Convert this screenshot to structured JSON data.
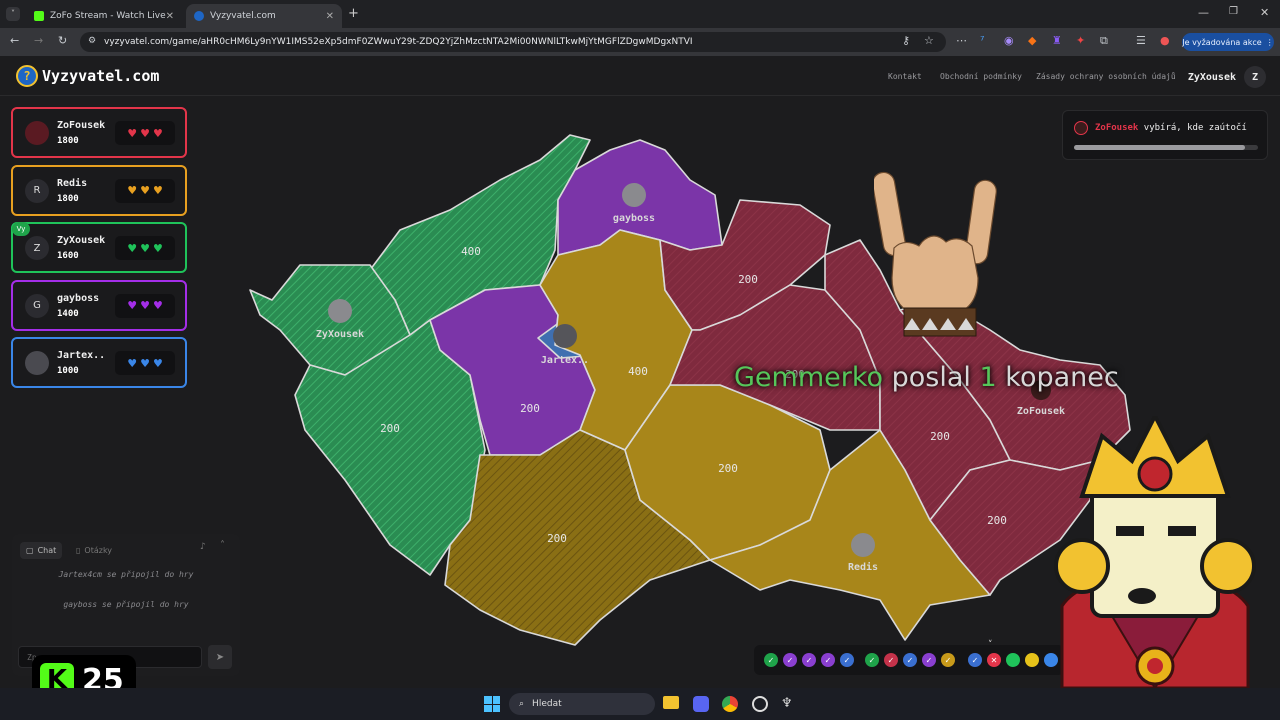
{
  "browser": {
    "tabs": [
      {
        "title": "ZoFo Stream - Watch Live on Ki",
        "active": false
      },
      {
        "title": "Vyzyvatel.com",
        "active": true
      }
    ],
    "url": "vyzyvatel.com/game/aHR0cHM6Ly9nYW1IMS52eXp5dmF0ZWwuY29t-ZDQ2YjZhMzctNTA2Mi00NWNlLTkwMjYtMGFlZDgwMDgxNTVI",
    "action_button": "Je vyžadována akce"
  },
  "site": {
    "logo": "Vyzyvatel.com",
    "nav": [
      "Kontakt",
      "Obchodní podmínky",
      "Zásady ochrany osobních údajů"
    ],
    "user": {
      "name": "ZyXousek",
      "initial": "Z"
    }
  },
  "players": [
    {
      "name": "ZoFousek",
      "score": "1800",
      "initial": "",
      "color": "#e3354a",
      "hearts": 3,
      "you": false
    },
    {
      "name": "Redis",
      "score": "1800",
      "initial": "R",
      "color": "#e8a020",
      "hearts": 3,
      "you": false
    },
    {
      "name": "ZyXousek",
      "score": "1600",
      "initial": "Z",
      "color": "#1fc35a",
      "hearts": 3,
      "you": true,
      "you_label": "Vy"
    },
    {
      "name": "gayboss",
      "score": "1400",
      "initial": "G",
      "color": "#a42ee8",
      "hearts": 3,
      "you": false
    },
    {
      "name": "Jartex..",
      "score": "1000",
      "initial": "",
      "color": "#3a86e8",
      "hearts": 3,
      "you": false
    }
  ],
  "status": {
    "player": "ZoFousek",
    "text": "vybírá, kde zaútočí",
    "progress": 0.93
  },
  "chat": {
    "tabs": [
      "Chat",
      "Otázky"
    ],
    "messages": [
      "Jartex4cm se připojil do hry",
      "gayboss se připojil do hry"
    ],
    "placeholder": "Zp..."
  },
  "map": {
    "regions": [
      {
        "id": "liberec-ustecky",
        "owner": "ZyXousek",
        "value": "400"
      },
      {
        "id": "karlovarsky",
        "owner": "ZyXousek",
        "value": "ZyXousek"
      },
      {
        "id": "plzensky",
        "owner": "ZyXousek",
        "value": "200"
      },
      {
        "id": "liberecky",
        "owner": "gayboss",
        "value": "gayboss"
      },
      {
        "id": "stredocesky-west",
        "owner": "gayboss",
        "value": "200"
      },
      {
        "id": "praha",
        "owner": "Jartex..",
        "value": "Jartex.."
      },
      {
        "id": "stredocesky-east",
        "owner": "Redis",
        "value": "400"
      },
      {
        "id": "jihocesky",
        "owner": "Redis",
        "value": "200"
      },
      {
        "id": "vysocina",
        "owner": "Redis",
        "value": "200"
      },
      {
        "id": "jihomoravsky",
        "owner": "Redis",
        "value": "Redis"
      },
      {
        "id": "kralovehradecky",
        "owner": "ZoFousek",
        "value": "200"
      },
      {
        "id": "pardubicky",
        "owner": "ZoFousek",
        "value": "200"
      },
      {
        "id": "olomoucky",
        "owner": "ZoFousek",
        "value": "200"
      },
      {
        "id": "moravskoslezsky",
        "owner": "ZoFousek",
        "value": "ZoFousek"
      },
      {
        "id": "zlinsky",
        "owner": "ZoFousek",
        "value": "200"
      }
    ]
  },
  "overlay": {
    "gift_user": "Gemmerko",
    "gift_mid": "poslal",
    "gift_count": "1",
    "gift_item": "kopanec"
  },
  "kick": {
    "count": "25"
  },
  "taskbar": {
    "search": "Hledat"
  },
  "chips": [
    "#1fa34a",
    "#8a3fd0",
    "#8a3fd0",
    "#8a3fd0",
    "#3a6fd0",
    "#1fa34a",
    "#c4324a",
    "#3a6fd0",
    "#8a3fd0",
    "#c89a1a",
    "#3a6fd0",
    "#e3354a",
    "#1fc35a",
    "#e6c21a",
    "#3a86e8"
  ]
}
